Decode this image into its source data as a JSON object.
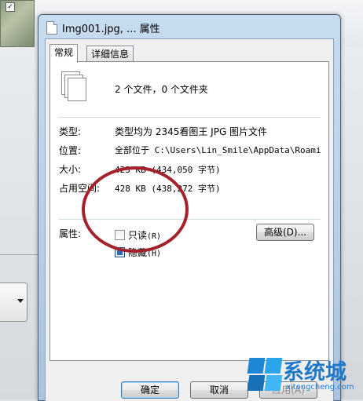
{
  "background": {
    "checkbox_mark": "✓"
  },
  "window": {
    "title": "Img001.jpg, ... 属性"
  },
  "tabs": [
    {
      "label": "常规",
      "active": true
    },
    {
      "label": "详细信息",
      "active": false
    }
  ],
  "general": {
    "summary": "2 个文件，0 个文件夹",
    "rows": [
      {
        "label": "类型:",
        "value": "类型均为 2345看图王 JPG 图片文件"
      },
      {
        "label": "位置:",
        "value": "全部位于 C:\\Users\\Lin_Smile\\AppData\\Roami"
      },
      {
        "label": "大小:",
        "value": "423 KB (434,050 字节)"
      },
      {
        "label": "占用空间:",
        "value": "428 KB (438,272 字节)"
      }
    ],
    "attributes": {
      "label": "属性:",
      "readonly": {
        "label": "只读",
        "key": "(R)",
        "checked": false
      },
      "hidden": {
        "label": "隐藏",
        "key": "(H)",
        "checked": true
      },
      "advanced_button": "高级(D)..."
    }
  },
  "buttons": {
    "ok": "确定",
    "cancel": "取消",
    "apply": "应用(A)"
  },
  "watermark": {
    "text": "系统城",
    "url": "xitongcheng.com"
  },
  "colors": {
    "annotation_circle": "#a3222b",
    "checkbox_checked": "#2a6bb8",
    "watermark": "#1f78c8"
  }
}
